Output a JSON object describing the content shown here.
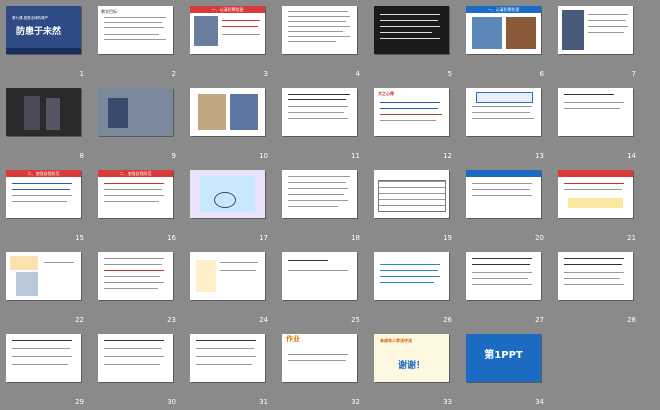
{
  "slides": [
    {
      "n": "1",
      "title": "防患于未然",
      "subtitle": "第七课 感受法律的尊严"
    },
    {
      "n": "2"
    },
    {
      "n": "3",
      "heading": "一、认清犯罪危害"
    },
    {
      "n": "4"
    },
    {
      "n": "5"
    },
    {
      "n": "6",
      "heading": "一、认清犯罪危害"
    },
    {
      "n": "7"
    },
    {
      "n": "8"
    },
    {
      "n": "9"
    },
    {
      "n": "10"
    },
    {
      "n": "11"
    },
    {
      "n": "12",
      "heading": "犬之心得"
    },
    {
      "n": "13"
    },
    {
      "n": "14"
    },
    {
      "n": "15",
      "heading": "二、加强自我防范"
    },
    {
      "n": "16",
      "heading": "二、加强自我防范"
    },
    {
      "n": "17"
    },
    {
      "n": "18"
    },
    {
      "n": "19"
    },
    {
      "n": "20"
    },
    {
      "n": "21"
    },
    {
      "n": "22"
    },
    {
      "n": "23"
    },
    {
      "n": "24"
    },
    {
      "n": "25"
    },
    {
      "n": "26"
    },
    {
      "n": "27"
    },
    {
      "n": "28"
    },
    {
      "n": "29"
    },
    {
      "n": "30"
    },
    {
      "n": "31"
    },
    {
      "n": "32",
      "heading": "作业"
    },
    {
      "n": "33",
      "heading": "未成年人学法守法",
      "thanks": "谢谢！"
    },
    {
      "n": "34",
      "logo": "第1PPT"
    }
  ]
}
